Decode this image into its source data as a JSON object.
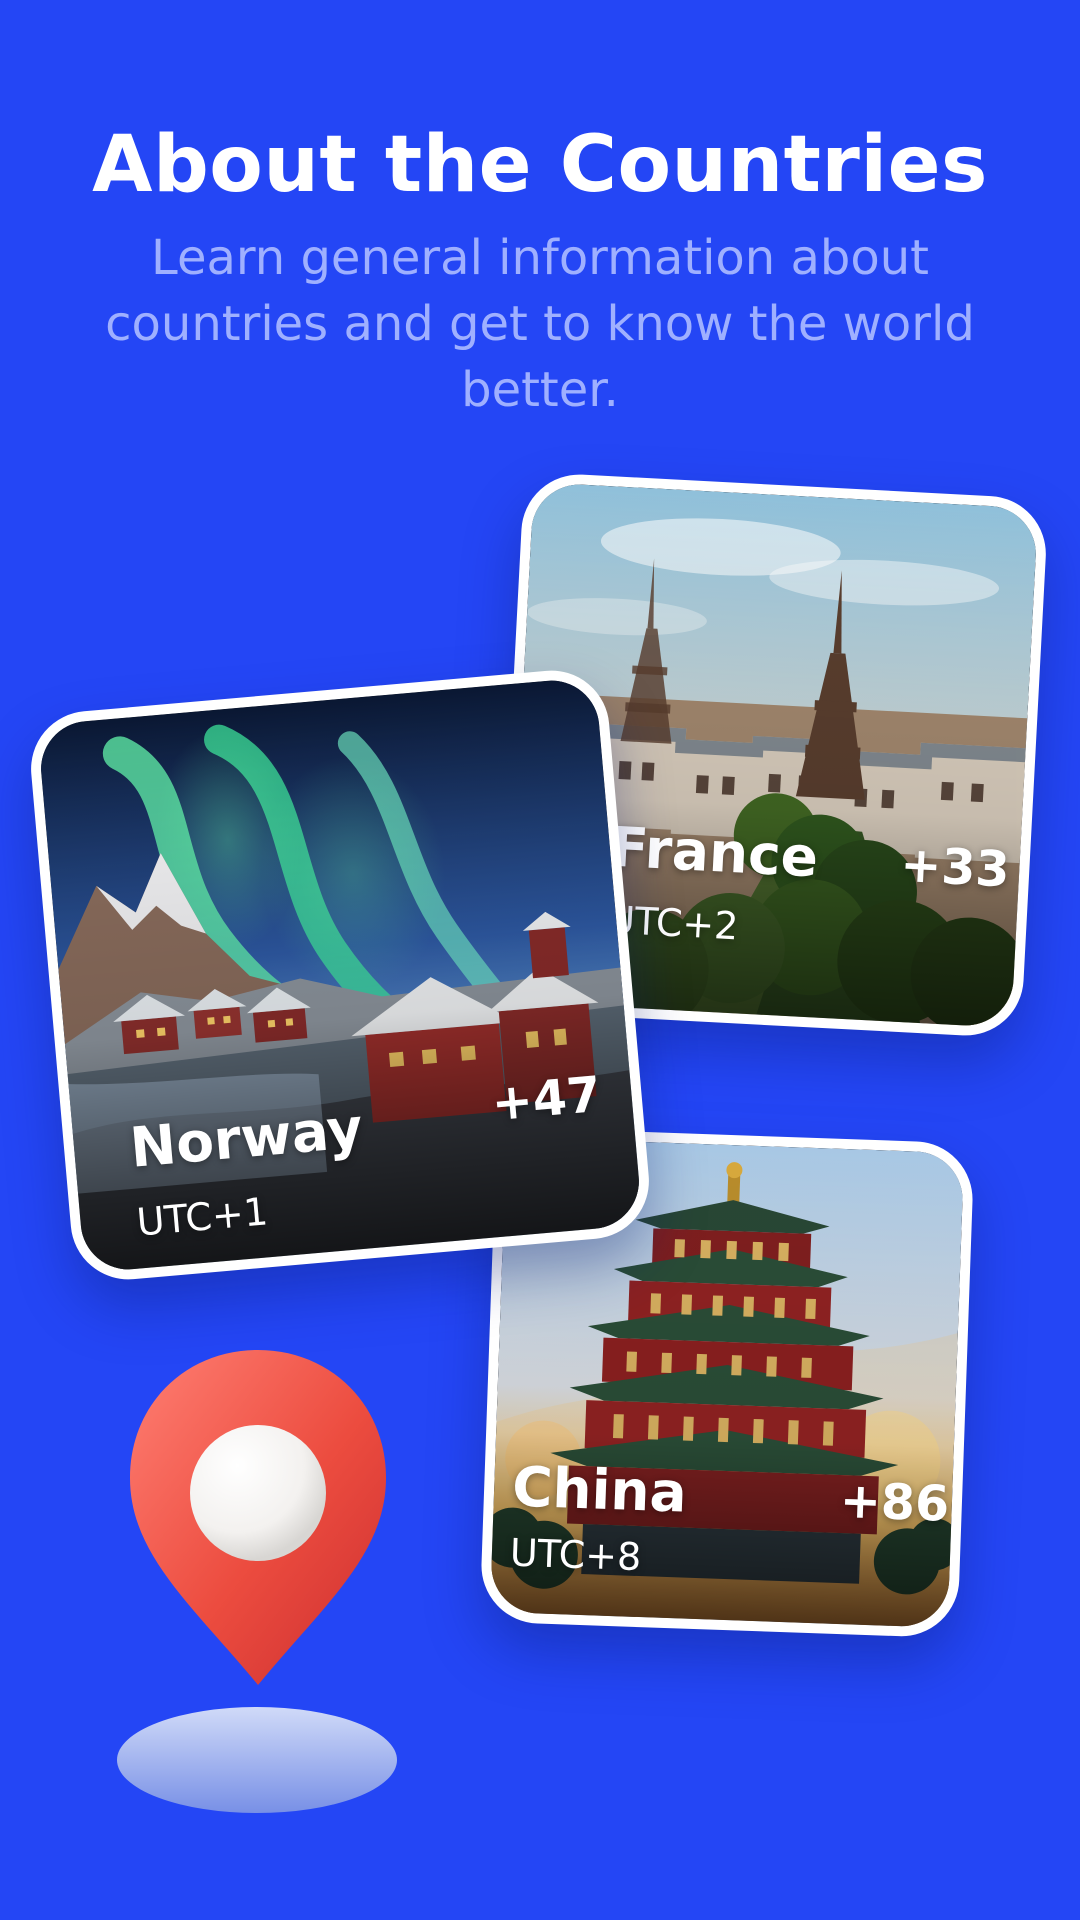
{
  "header": {
    "title": "About the Countries",
    "subtitle": "Learn general information about countries and get to know the world better."
  },
  "cards": {
    "france": {
      "name": "France",
      "timezone": "UTC+2",
      "dial_code": "+33",
      "image_icon": "eiffel-tower-icon"
    },
    "norway": {
      "name": "Norway",
      "timezone": "UTC+1",
      "dial_code": "+47",
      "image_icon": "northern-lights-icon"
    },
    "china": {
      "name": "China",
      "timezone": "UTC+8",
      "dial_code": "+86",
      "image_icon": "pagoda-icon"
    }
  },
  "decor": {
    "location_icon": "map-pin-icon"
  },
  "colors": {
    "background": "#2446f5",
    "title": "#ffffff",
    "subtitle": "#9fb0ff",
    "card_border": "#ffffff",
    "pin": "#e7493b"
  }
}
